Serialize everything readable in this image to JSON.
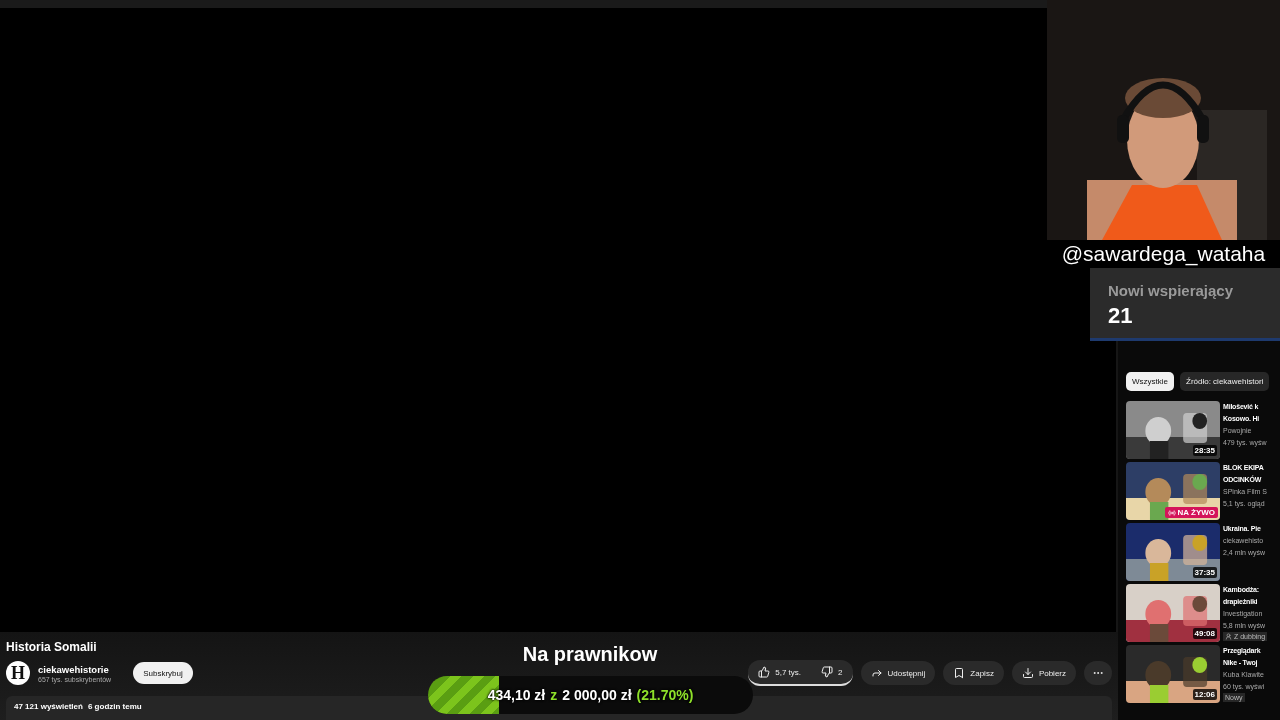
{
  "overlay": {
    "handle": "@sawardega_wataha",
    "supporters": {
      "label": "Nowi wspierający",
      "count": "21"
    },
    "goal": {
      "title": "Na prawnikow",
      "level": 0.217,
      "raised": "434,10 zł",
      "separator": "z",
      "target": "2 000,00 zł",
      "percent": "(21.70%)"
    }
  },
  "video": {
    "title": "Historia Somalii",
    "channel": {
      "avatar_letter": "H",
      "name": "ciekawehistorie",
      "subscribers": "657 tys. subskrybentów",
      "subscribe": "Subskrybuj"
    },
    "actions": [
      {
        "kind": "like",
        "label": "5,7 tys."
      },
      {
        "kind": "dislike",
        "label": "2"
      },
      {
        "kind": "share",
        "label": "Udostępnij"
      },
      {
        "kind": "save",
        "label": "Zapisz"
      },
      {
        "kind": "download",
        "label": "Pobierz"
      },
      {
        "kind": "more"
      }
    ],
    "description": {
      "views": "47 121 wyświetleń",
      "time": "6 godzin temu"
    }
  },
  "sidebar": {
    "chips": [
      {
        "label": "Wszystkie",
        "selected": true
      },
      {
        "label": "Źródło: ciekawehistori",
        "selected": false
      }
    ],
    "videos": [
      {
        "title": [
          "Milošević k",
          "Kosowo. Hi"
        ],
        "channel": "Powojnie",
        "meta": "479 tys. wyśw",
        "duration": "28:35"
      },
      {
        "title": [
          "BLOK EKIPA",
          "ODCINKÓW"
        ],
        "channel": "SPinka Film S",
        "meta": "5,1 tys. ogląd",
        "live": "NA ŻYWO"
      },
      {
        "title": [
          "Ukraina. Pie"
        ],
        "channel": "ciekawehisto",
        "meta": "2,4 mln wyśw",
        "duration": "37:35"
      },
      {
        "title": [
          "Kambodża:",
          "drapieżniki"
        ],
        "channel": "Investigation",
        "meta": "5,8 mln wyśw",
        "badge": "Z dubbing",
        "duration": "49:08"
      },
      {
        "title": [
          "Przeglądark",
          "Nike - Twoj"
        ],
        "channel": "Kuba Klawite",
        "meta": "60 tys. wyświ",
        "badge": "Nowy",
        "duration": "12:06"
      }
    ]
  }
}
